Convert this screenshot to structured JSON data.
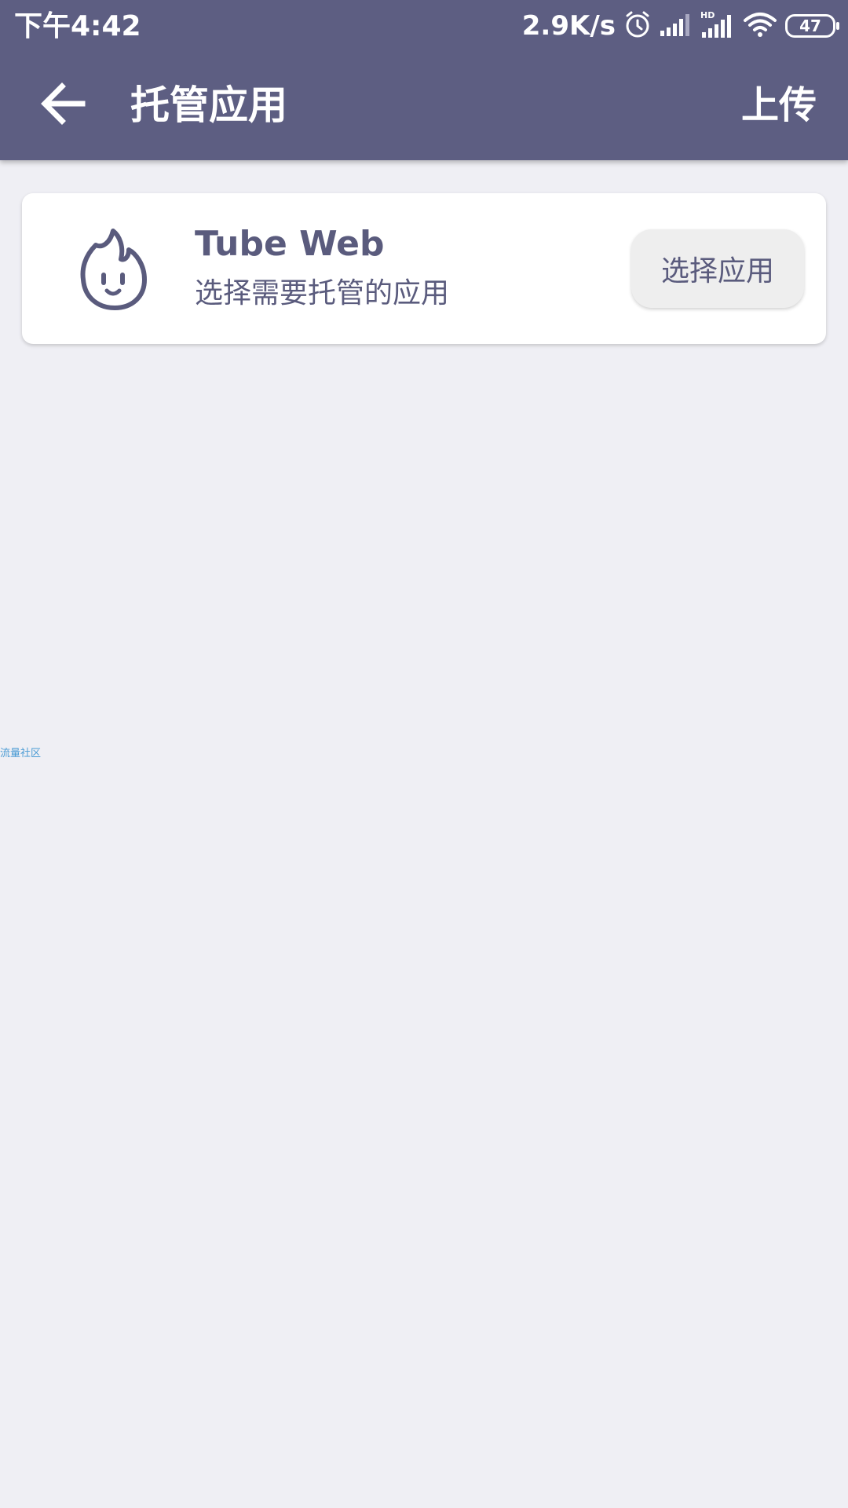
{
  "status_bar": {
    "time": "下午4:42",
    "net_speed": "2.9K/s",
    "battery_level": "47",
    "icons": [
      "alarm-icon",
      "signal-icon",
      "hd-signal-icon",
      "wifi-icon",
      "battery-icon"
    ]
  },
  "app_bar": {
    "title": "托管应用",
    "upload_label": "上传",
    "back_icon": "arrow-left-icon"
  },
  "card": {
    "app_name": "Tube Web",
    "description": "选择需要托管的应用",
    "button_label": "选择应用",
    "icon": "flame-face-icon"
  },
  "watermark": "流量社区",
  "colors": {
    "primary": "#5d5e82",
    "background": "#efeff4",
    "card": "#ffffff",
    "text_primary": "#5a5b7d",
    "button_bg": "#eeeeee"
  }
}
